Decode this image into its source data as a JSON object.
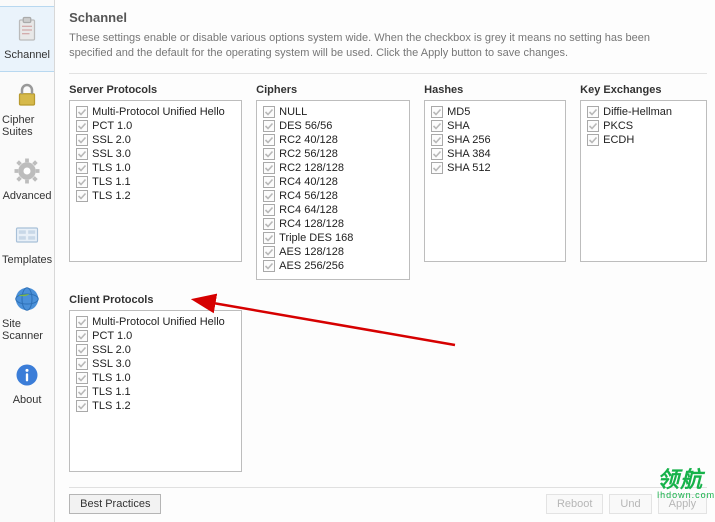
{
  "sidebar": {
    "items": [
      {
        "label": "Schannel",
        "icon": "clipboard-icon",
        "selected": true
      },
      {
        "label": "Cipher Suites",
        "icon": "lock-icon",
        "selected": false
      },
      {
        "label": "Advanced",
        "icon": "gear-icon",
        "selected": false
      },
      {
        "label": "Templates",
        "icon": "templates-icon",
        "selected": false
      },
      {
        "label": "Site Scanner",
        "icon": "globe-icon",
        "selected": false
      },
      {
        "label": "About",
        "icon": "info-icon",
        "selected": false
      }
    ]
  },
  "page": {
    "title": "Schannel",
    "description": "These settings enable or disable various options system wide. When the checkbox is grey it means no setting has been specified and the default for the operating system will be used. Click the Apply button to save changes."
  },
  "groups": {
    "server_title": "Server Protocols",
    "server": [
      "Multi-Protocol Unified Hello",
      "PCT 1.0",
      "SSL 2.0",
      "SSL 3.0",
      "TLS 1.0",
      "TLS 1.1",
      "TLS 1.2"
    ],
    "ciphers_title": "Ciphers",
    "ciphers": [
      "NULL",
      "DES 56/56",
      "RC2 40/128",
      "RC2 56/128",
      "RC2 128/128",
      "RC4 40/128",
      "RC4 56/128",
      "RC4 64/128",
      "RC4 128/128",
      "Triple DES 168",
      "AES 128/128",
      "AES 256/256"
    ],
    "hashes_title": "Hashes",
    "hashes": [
      "MD5",
      "SHA",
      "SHA 256",
      "SHA 384",
      "SHA 512"
    ],
    "key_title": "Key Exchanges",
    "key": [
      "Diffie-Hellman",
      "PKCS",
      "ECDH"
    ],
    "client_title": "Client Protocols",
    "client": [
      "Multi-Protocol Unified Hello",
      "PCT 1.0",
      "SSL 2.0",
      "SSL 3.0",
      "TLS 1.0",
      "TLS 1.1",
      "TLS 1.2"
    ]
  },
  "buttons": {
    "best_practices": "Best Practices",
    "reboot": "Reboot",
    "und": "Und",
    "apply": "Apply"
  },
  "watermark": {
    "brand": "领航",
    "sub": "lhdown.com"
  }
}
